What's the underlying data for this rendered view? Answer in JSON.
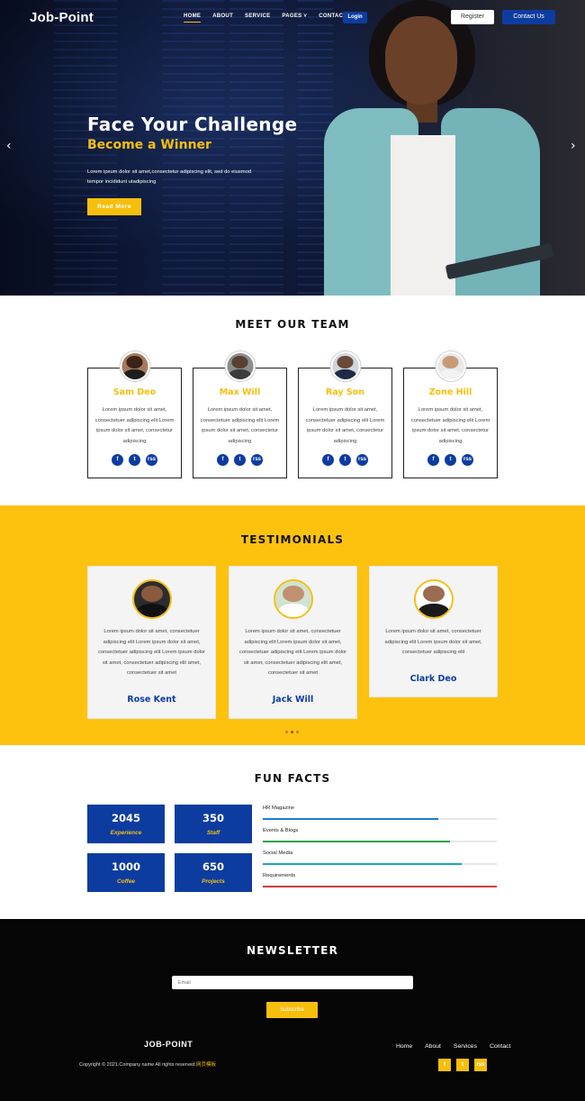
{
  "nav": {
    "logo": "Job-Point",
    "items": [
      "HOME",
      "ABOUT",
      "SERVICE",
      "PAGES ˅",
      "CONTACT"
    ],
    "login": "Login",
    "register": "Register",
    "contact": "Contact Us"
  },
  "hero": {
    "title": "Face Your Challenge",
    "subtitle": "Become a Winner",
    "text": "Lorem ipsum dolor sit amet,consectetur adipiscing elit, sed do eiusmod tempor incididunt utadipiscing",
    "button": "Read More",
    "prev_icon": "‹",
    "next_icon": "›"
  },
  "team": {
    "title": "MEET OUR TEAM",
    "bio": "Lorem ipsum dolor sit amet, consectetuer adipiscing elit Lorem ipsum dolor sit amet, consectetur adipiscing",
    "members": [
      {
        "name": "Sam Deo"
      },
      {
        "name": "Max Will"
      },
      {
        "name": "Ray Son"
      },
      {
        "name": "Zone Hill"
      }
    ],
    "social_icons": [
      "f",
      "t",
      "rss"
    ]
  },
  "testimonials": {
    "title": "TESTIMONIALS",
    "items": [
      {
        "name": "Rose Kent",
        "text": "Lorem ipsum dolor sit amet, consectetuer adipiscing elit Lorem ipsum dolor sit amet, consectetuer adipiscing elit Lorem ipsum dolor sit amet, consectetuer adipiscing elit amet, consectetuer sit amet"
      },
      {
        "name": "Jack Will",
        "text": "Lorem ipsum dolor sit amet, consectetuer adipiscing elit Lorem ipsum dolor sit amet, consectetuer adipiscing elit Lorem ipsum dolor sit amet, consectetuer adipiscing elit amet, consectetuer sit amet"
      },
      {
        "name": "Clark Deo",
        "text": "Lorem ipsum dolor sit amet, consectetuer adipiscing elit Lorem ipsum dolor sit amet, consectetuer adipiscing elit"
      }
    ]
  },
  "facts": {
    "title": "FUN FACTS",
    "boxes": [
      {
        "num": "2045",
        "label": "Experience"
      },
      {
        "num": "350",
        "label": "Staff"
      },
      {
        "num": "1000",
        "label": "Coffee"
      },
      {
        "num": "650",
        "label": "Projects"
      }
    ],
    "skills": [
      {
        "label": "HR Magazine",
        "percent": 75,
        "color": "#1e7bd6"
      },
      {
        "label": "Events & Blogs",
        "percent": 80,
        "color": "#2aa64a"
      },
      {
        "label": "Social Media",
        "percent": 85,
        "color": "#1aa3c7"
      },
      {
        "label": "Requirements",
        "percent": 100,
        "color": "#d83a3a"
      }
    ]
  },
  "footer": {
    "newsletter_title": "NEWSLETTER",
    "email_placeholder": "Email",
    "subscribe": "Subscribe",
    "brand": "JOB-POINT",
    "copyright": "Copyright © 2021.Company name All rights reserved.",
    "copyright_highlight": "网页模板",
    "links": [
      "Home",
      "About",
      "Services",
      "Contact"
    ],
    "social_icons": [
      "f",
      "t",
      "rss"
    ]
  },
  "colors": {
    "accent": "#f6bf0e",
    "brand_blue": "#0d3ca1",
    "dark": "#050505"
  }
}
